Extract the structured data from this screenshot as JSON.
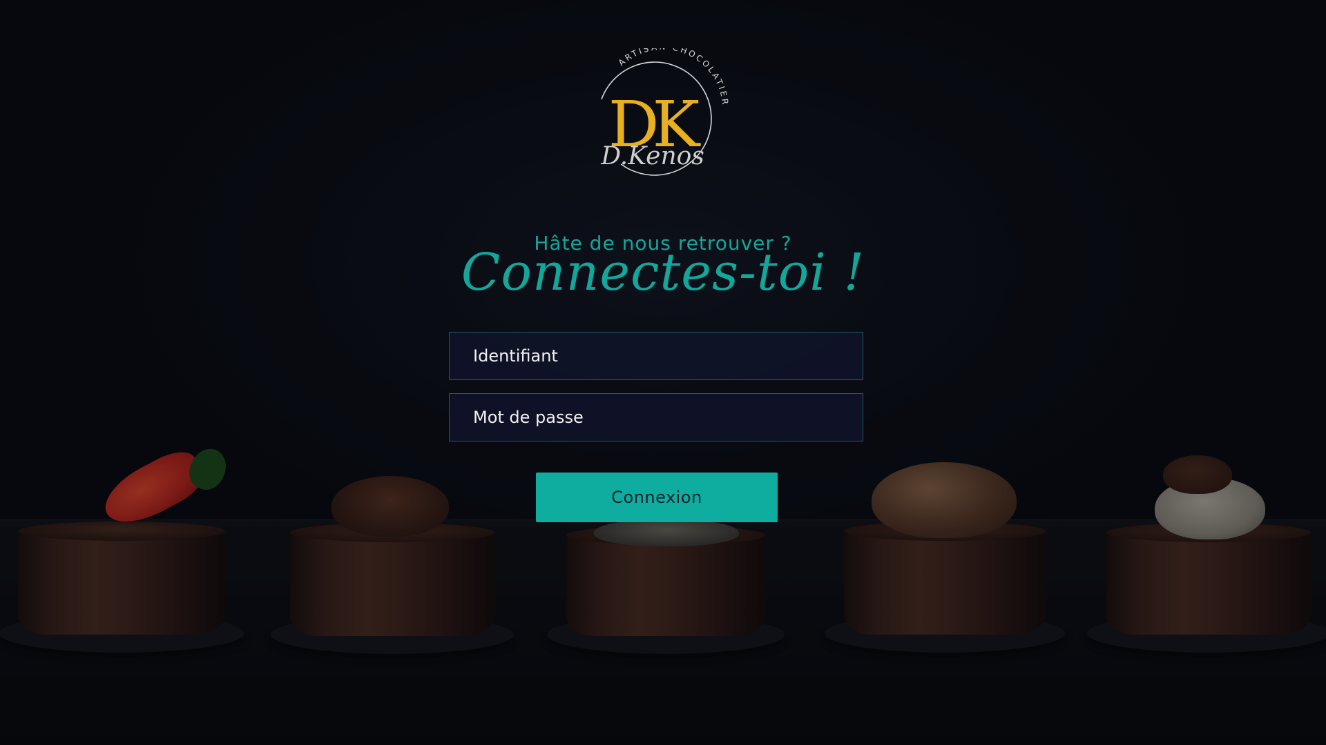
{
  "brand": {
    "monogram": "DK",
    "tagline": "ARTISAN CHOCOLATIER",
    "signature": "D.Kenos",
    "colors": {
      "monogram": "#e8b020",
      "accent": "#13a79b"
    }
  },
  "heading": {
    "subtitle": "Hâte de nous retrouver ?",
    "title": "Connectes-toi !"
  },
  "form": {
    "username_placeholder": "Identifiant",
    "password_placeholder": "Mot de passe",
    "submit_label": "Connexion"
  },
  "background": {
    "description_icon": "chocolate-desserts-photo"
  }
}
